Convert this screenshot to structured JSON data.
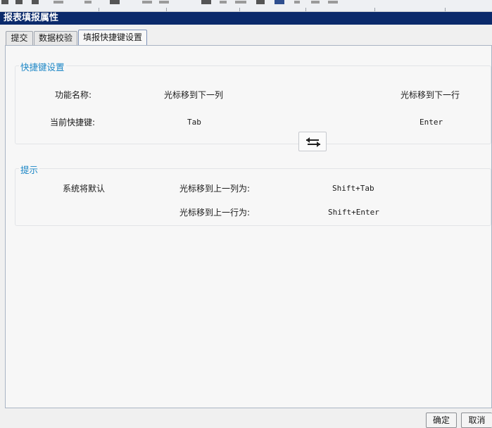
{
  "dialog": {
    "title": "报表填报属性"
  },
  "tabs": [
    {
      "label": "提交"
    },
    {
      "label": "数据校验"
    },
    {
      "label": "填报快捷键设置"
    }
  ],
  "shortcut_group": {
    "title": "快捷键设置",
    "func_name_label": "功能名称:",
    "func_1": "光标移到下一列",
    "func_2": "光标移到下一行",
    "current_label": "当前快捷键:",
    "key_1": "Tab",
    "key_2": "Enter",
    "swap_icon": "swap-arrows-icon"
  },
  "hint_group": {
    "title": "提示",
    "default_label": "系统将默认",
    "prev_col_label": "光标移到上一列为:",
    "prev_col_key": "Shift+Tab",
    "prev_row_label": "光标移到上一行为:",
    "prev_row_key": "Shift+Enter"
  },
  "buttons": {
    "ok": "确定",
    "cancel": "取消"
  },
  "colors": {
    "titlebar": "#0b2a6b",
    "group_title": "#1b86c6"
  }
}
